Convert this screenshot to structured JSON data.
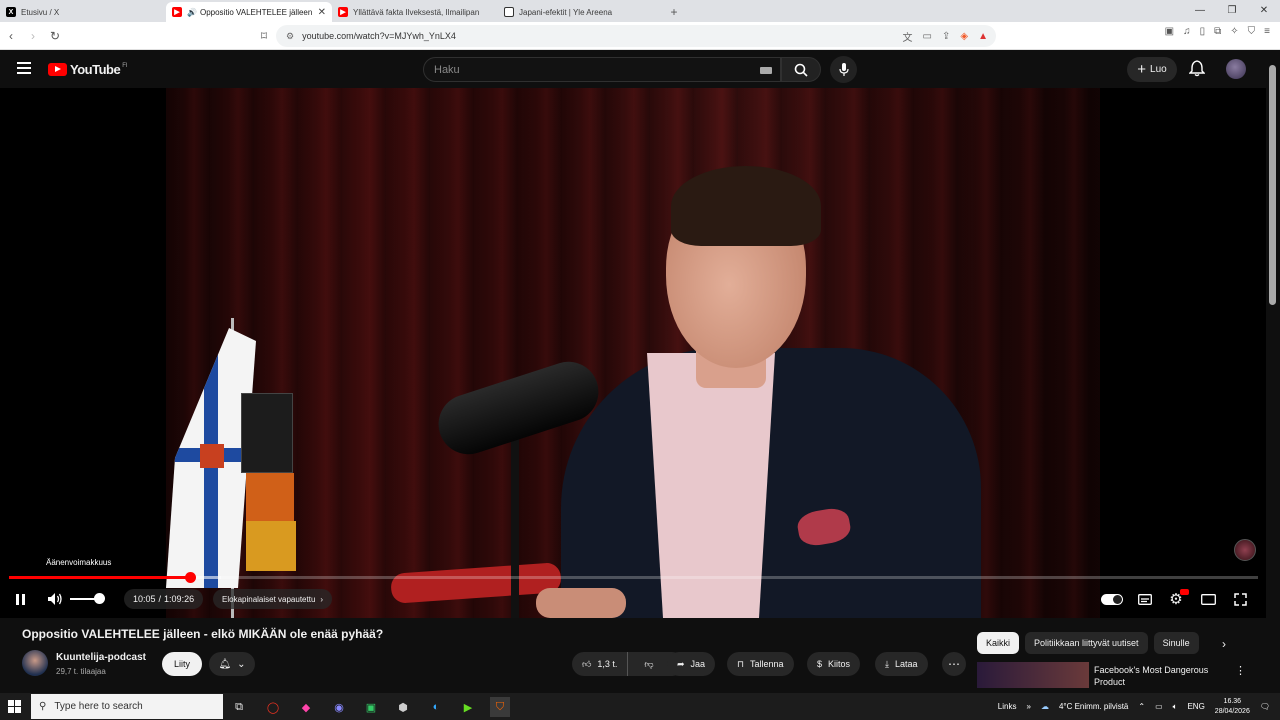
{
  "browser": {
    "tabs": [
      {
        "title": "Etusivu / X",
        "icon": "x-logo-icon",
        "active": false
      },
      {
        "title": "Oppositio VALEHTELEE jälleen",
        "icon": "youtube-icon",
        "active": true
      },
      {
        "title": "Yllättävä fakta Ilveksestä, Ilmailipan",
        "icon": "youtube-icon",
        "active": false
      },
      {
        "title": "Japani-efektit | Yle Areena",
        "icon": "yle-icon",
        "active": false
      }
    ],
    "url": "youtube.com/watch?v=MJYwh_YnLX4"
  },
  "youtube": {
    "logo_text": "YouTube",
    "region": "FI",
    "search_placeholder": "Haku",
    "create_label": "Luo"
  },
  "player": {
    "volume_tooltip": "Äänenvoimakkuus",
    "current_time": "10:05",
    "duration": "1:09:26",
    "progress_fraction": 0.145,
    "buffered_fraction": 0.17,
    "volume_fraction": 0.75,
    "chapter": "Elokapinalaiset vapautettu",
    "playing": true
  },
  "video": {
    "title": "Oppositio VALEHTELEE jälleen - elkö MIKÄÄN ole enää pyhää?",
    "channel": "Kuuntelija-podcast",
    "subscribers": "29,7 t. tilaajaa",
    "join_label": "Liity",
    "likes": "1,3 t.",
    "share_label": "Jaa",
    "save_label": "Tallenna",
    "thanks_label": "Kiitos",
    "download_label": "Lataa"
  },
  "sidebar": {
    "chips": [
      "Kaikki",
      "Politiikkaan liittyvät uutiset",
      "Sinulle"
    ],
    "selected_chip": "Kaikki",
    "recommendation_title": "Facebook's Most Dangerous Product"
  },
  "taskbar": {
    "search_placeholder": "Type here to search",
    "links_label": "Links",
    "weather": "4°C  Enimm. pilvistä",
    "language": "ENG",
    "time": "16.36",
    "date": "28/04/2026"
  }
}
